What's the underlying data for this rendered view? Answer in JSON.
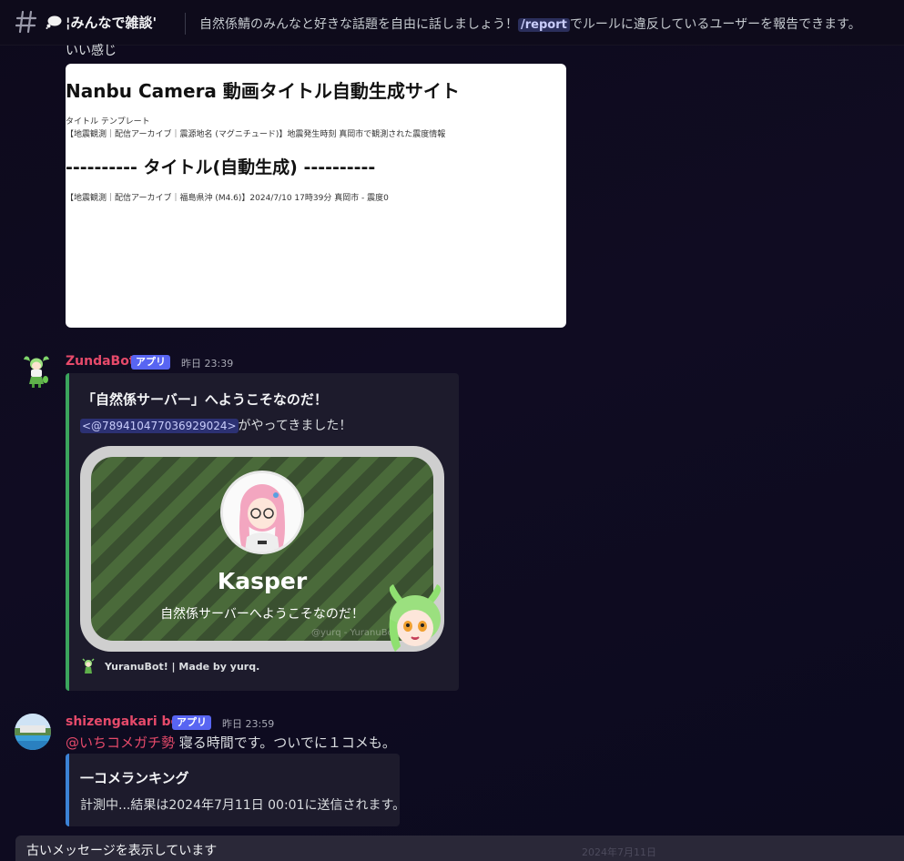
{
  "header": {
    "channel_name": "¦みんなで雑談'",
    "topic_before": "自然係鯖のみんなと好きな話題を自由に話しましょう！",
    "topic_command": "/report",
    "topic_after": "でルールに違反しているユーザーを報告できます。"
  },
  "prior_message": {
    "text": "いい感じ",
    "webpage": {
      "title": "Nanbu Camera 動画タイトル自動生成サイト",
      "template_label": "タイトル テンプレート",
      "template": "【地震観測｜配信アーカイブ｜震源地名 (マグニチュード)】地震発生時刻 真岡市で観測された震度情報",
      "section": "---------- タイトル(自動生成) ----------",
      "result": "【地震観測｜配信アーカイブ｜福島県沖 (M4.6)】2024/7/10 17時39分 真岡市 - 震度0"
    }
  },
  "zunda_message": {
    "username": "ZundaBot",
    "badge": "アプリ",
    "timestamp": "昨日 23:39",
    "embed": {
      "title": "「自然係サーバー」へようこそなのだ！",
      "mention": "<@789410477036929024>",
      "desc_after": "がやってきました！",
      "welcome_name": "Kasper",
      "welcome_sub": "自然係サーバーへようこそなのだ！",
      "credit": "@yurq - YuranuBot!",
      "footer": "YuranuBot! | Made by yurq."
    },
    "accent_color": "#3ba55d"
  },
  "shizen_message": {
    "username": "shizengakari bot",
    "badge": "アプリ",
    "timestamp": "昨日 23:59",
    "mention": "@いちコメガチ勢",
    "text": " 寝る時間です。ついでに１コメも。",
    "embed": {
      "title": "一コメランキング",
      "desc": "計測中...結果は2024年7月11日 00:01に送信されます。"
    },
    "accent_color": "#3b82d6"
  },
  "old_messages_bar": {
    "text": "古いメッセージを表示しています",
    "date": "2024年7月11日"
  }
}
